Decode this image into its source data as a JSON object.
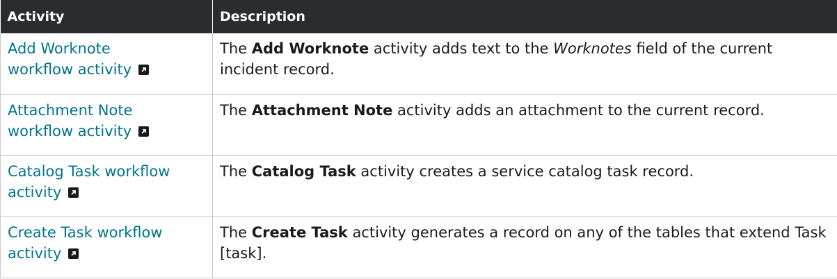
{
  "table": {
    "headers": [
      "Activity",
      "Description"
    ],
    "rows": [
      {
        "activity": "Add Worknote workflow activity",
        "activity_line1": "Add Worknote",
        "activity_line2": "workflow activity",
        "desc_pre": "The ",
        "desc_bold": "Add Worknote",
        "desc_mid": " activity adds text to the ",
        "desc_italic": "Worknotes",
        "desc_post": " field of the current incident record."
      },
      {
        "activity": "Attachment Note workflow activity",
        "activity_line1": "Attachment Note",
        "activity_line2": "workflow activity",
        "desc_pre": "The ",
        "desc_bold": "Attachment Note",
        "desc_post": " activity adds an attachment to the current record."
      },
      {
        "activity": "Catalog Task workflow activity",
        "activity_line1": "Catalog Task workflow",
        "activity_line2": "activity",
        "desc_pre": "The ",
        "desc_bold": "Catalog Task",
        "desc_post": " activity creates a service catalog task record."
      },
      {
        "activity": "Create Task workflow activity",
        "activity_line1": "Create Task workflow",
        "activity_line2": "activity",
        "desc_pre": "The ",
        "desc_bold": "Create Task",
        "desc_post": " activity generates a record on any of the tables that extend Task [task]."
      }
    ]
  },
  "icons": {
    "external_link": "external-link-icon"
  },
  "colors": {
    "header_bg": "#2a2d30",
    "link": "#00748a",
    "border": "#c8c8c8"
  }
}
